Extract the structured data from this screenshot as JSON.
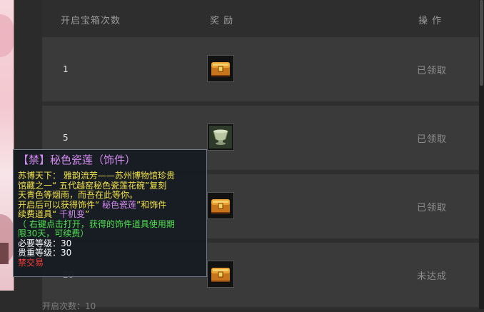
{
  "header": {
    "col_count": "开启宝箱次数",
    "col_reward": "奖 励",
    "col_action": "操 作"
  },
  "rows": [
    {
      "count": "1",
      "reward_icon": "treasure-chest-icon",
      "status": "已领取"
    },
    {
      "count": "5",
      "reward_icon": "porcelain-bowl-icon",
      "status": "已领取"
    },
    {
      "count": "",
      "reward_icon": "treasure-chest-icon",
      "status": "已领取"
    },
    {
      "count": "20",
      "reward_icon": "treasure-chest-icon",
      "status": "未达成"
    }
  ],
  "footer": {
    "opened_label": "开启次数：10"
  },
  "tooltip": {
    "title": "【禁】秘色瓷莲（饰件）",
    "desc_line1": "苏博天下： 雅韵流芳——苏州博物馆珍贵",
    "desc_line2": "馆藏之一“ 五代越窑秘色瓷莲花碗”复刻",
    "desc_line3": "天青色等烟雨，而吾在此等你。",
    "gain_a": "开启后可以获得饰件“",
    "gain_item": " 秘色瓷莲",
    "gain_b": "”和饰件",
    "gain_c": "续费道具“ ",
    "gain_item2": "千机变",
    "gain_d": "”",
    "hint_line1": "（ 右键点击打开，获得的饰件道具使用期",
    "hint_line2": "限30天，可续费）",
    "req_level": "必要等级：30",
    "noble_level": "贵重等级：30",
    "no_trade": "禁交易"
  },
  "colors": {
    "tooltip_title": "#d58cf0",
    "desc": "#f2e24a",
    "gain": "#4ee04e",
    "no_trade": "#ff3b3b",
    "status": "#8f8f8f"
  }
}
